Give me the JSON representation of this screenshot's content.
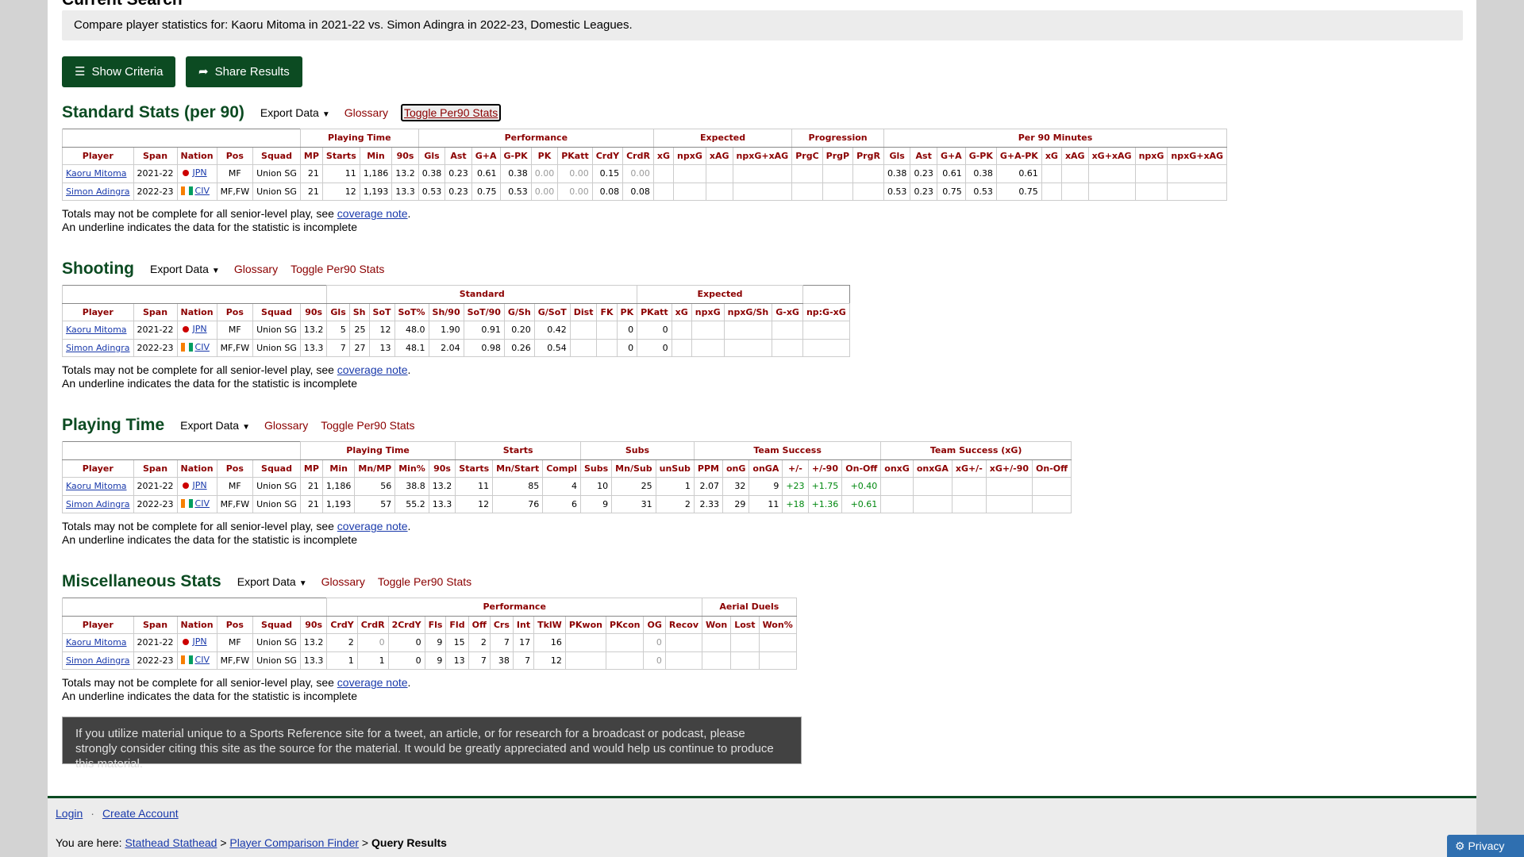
{
  "current_search": {
    "heading": "Current Search",
    "text": "Compare player statistics for: Kaoru Mitoma in 2021-22 vs. Simon Adingra in 2022-23, Domestic Leagues."
  },
  "buttons": {
    "show_criteria": "Show Criteria",
    "share_results": "Share Results"
  },
  "links": {
    "export": "Export Data",
    "glossary": "Glossary",
    "toggle": "Toggle Per90 Stats"
  },
  "flags": {
    "jpn": [
      "#ffffff",
      "#cc0000"
    ],
    "civ": [
      "#f77f00",
      "#ffffff",
      "#009e60"
    ]
  },
  "players": [
    {
      "name": "Kaoru Mitoma",
      "span": "2021-22",
      "nation": "JPN",
      "flag": "jpn",
      "pos": "MF",
      "squad": "Union SG"
    },
    {
      "name": "Simon Adingra",
      "span": "2022-23",
      "nation": "CIV",
      "flag": "civ",
      "pos": "MF,FW",
      "squad": "Union SG"
    }
  ],
  "notes": {
    "totals_prefix": "Totals may not be complete for all senior-level play, see ",
    "coverage_link": "coverage note",
    "totals_suffix": ".",
    "underline": "An underline indicates the data for the statistic is incomplete"
  },
  "sections": [
    {
      "id": "standard",
      "title": "Standard Stats (per 90)",
      "focused_toggle": true,
      "groups": [
        {
          "label": "",
          "span": 5
        },
        {
          "label": "Playing Time",
          "span": 4
        },
        {
          "label": "Performance",
          "span": 8
        },
        {
          "label": "Expected",
          "span": 4
        },
        {
          "label": "Progression",
          "span": 3
        },
        {
          "label": "Per 90 Minutes",
          "span": 10
        }
      ],
      "columns": [
        "Player",
        "Span",
        "Nation",
        "Pos",
        "Squad",
        "MP",
        "Starts",
        "Min",
        "90s",
        "Gls",
        "Ast",
        "G+A",
        "G-PK",
        "PK",
        "PKatt",
        "CrdY",
        "CrdR",
        "xG",
        "npxG",
        "xAG",
        "npxG+xAG",
        "PrgC",
        "PrgP",
        "PrgR",
        "Gls",
        "Ast",
        "G+A",
        "G-PK",
        "G+A-PK",
        "xG",
        "xAG",
        "xG+xAG",
        "npxG",
        "npxG+xAG"
      ],
      "rows": [
        [
          "21",
          "11",
          "1,186",
          "13.2",
          "0.38",
          "0.23",
          "0.61",
          "0.38",
          "0.00",
          "0.00",
          "0.15",
          "0.00",
          "",
          "",
          "",
          "",
          "",
          "",
          "",
          "0.38",
          "0.23",
          "0.61",
          "0.38",
          "0.61",
          "",
          "",
          "",
          "",
          ""
        ],
        [
          "21",
          "12",
          "1,193",
          "13.3",
          "0.53",
          "0.23",
          "0.75",
          "0.53",
          "0.00",
          "0.00",
          "0.08",
          "0.08",
          "",
          "",
          "",
          "",
          "",
          "",
          "",
          "0.53",
          "0.23",
          "0.75",
          "0.53",
          "0.75",
          "",
          "",
          "",
          "",
          ""
        ]
      ]
    },
    {
      "id": "shooting",
      "title": "Shooting",
      "focused_toggle": false,
      "groups": [
        {
          "label": "",
          "span": 6
        },
        {
          "label": "Standard",
          "span": 11
        },
        {
          "label": "Expected",
          "span": 5
        }
      ],
      "columns": [
        "Player",
        "Span",
        "Nation",
        "Pos",
        "Squad",
        "90s",
        "Gls",
        "Sh",
        "SoT",
        "SoT%",
        "Sh/90",
        "SoT/90",
        "G/Sh",
        "G/SoT",
        "Dist",
        "FK",
        "PK",
        "PKatt",
        "xG",
        "npxG",
        "npxG/Sh",
        "G-xG",
        "np:G-xG"
      ],
      "rows": [
        [
          "13.2",
          "5",
          "25",
          "12",
          "48.0",
          "1.90",
          "0.91",
          "0.20",
          "0.42",
          "",
          "",
          "0",
          "0",
          "",
          "",
          "",
          "",
          ""
        ],
        [
          "13.3",
          "7",
          "27",
          "13",
          "48.1",
          "2.04",
          "0.98",
          "0.26",
          "0.54",
          "",
          "",
          "0",
          "0",
          "",
          "",
          "",
          "",
          ""
        ]
      ]
    },
    {
      "id": "playing",
      "title": "Playing Time",
      "focused_toggle": false,
      "groups": [
        {
          "label": "",
          "span": 5
        },
        {
          "label": "Playing Time",
          "span": 5
        },
        {
          "label": "Starts",
          "span": 3
        },
        {
          "label": "Subs",
          "span": 3
        },
        {
          "label": "Team Success",
          "span": 6
        },
        {
          "label": "Team Success (xG)",
          "span": 5
        }
      ],
      "columns": [
        "Player",
        "Span",
        "Nation",
        "Pos",
        "Squad",
        "MP",
        "Min",
        "Mn/MP",
        "Min%",
        "90s",
        "Starts",
        "Mn/Start",
        "Compl",
        "Subs",
        "Mn/Sub",
        "unSub",
        "PPM",
        "onG",
        "onGA",
        "+/-",
        "+/-90",
        "On-Off",
        "onxG",
        "onxGA",
        "xG+/-",
        "xG+/-90",
        "On-Off"
      ],
      "rows": [
        [
          "21",
          "1,186",
          "56",
          "38.8",
          "13.2",
          "11",
          "85",
          "4",
          "10",
          "25",
          "1",
          "2.07",
          "32",
          "9",
          "+23",
          "+1.75",
          "+0.40",
          "",
          "",
          "",
          "",
          ""
        ],
        [
          "21",
          "1,193",
          "57",
          "55.2",
          "13.3",
          "12",
          "76",
          "6",
          "9",
          "31",
          "2",
          "2.33",
          "29",
          "11",
          "+18",
          "+1.36",
          "+0.61",
          "",
          "",
          "",
          "",
          ""
        ]
      ]
    },
    {
      "id": "misc",
      "title": "Miscellaneous Stats",
      "focused_toggle": false,
      "groups": [
        {
          "label": "",
          "span": 6
        },
        {
          "label": "Performance",
          "span": 13
        },
        {
          "label": "Aerial Duels",
          "span": 3
        }
      ],
      "columns": [
        "Player",
        "Span",
        "Nation",
        "Pos",
        "Squad",
        "90s",
        "CrdY",
        "CrdR",
        "2CrdY",
        "Fls",
        "Fld",
        "Off",
        "Crs",
        "Int",
        "TklW",
        "PKwon",
        "PKcon",
        "OG",
        "Recov",
        "Won",
        "Lost",
        "Won%"
      ],
      "rows": [
        [
          "13.2",
          "2",
          "0",
          "0",
          "9",
          "15",
          "2",
          "7",
          "17",
          "16",
          "",
          "",
          "0",
          "",
          "",
          "",
          ""
        ],
        [
          "13.3",
          "1",
          "1",
          "0",
          "9",
          "13",
          "7",
          "38",
          "7",
          "12",
          "",
          "",
          "0",
          "",
          "",
          "",
          ""
        ]
      ]
    }
  ],
  "citation": "If you utilize material unique to a Sports Reference site for a tweet, an article, or for research for a broadcast or podcast, please strongly consider citing this site as the source for the material. It would be greatly appreciated and would help us continue to produce this material.",
  "footer": {
    "login": "Login",
    "separator": "·",
    "create_account": "Create Account",
    "you_are_here": "You are here: ",
    "crumbs": [
      "Stathead Stathead",
      "Player Comparison Finder"
    ],
    "sep": " > ",
    "current": "Query Results"
  },
  "privacy": "Privacy"
}
